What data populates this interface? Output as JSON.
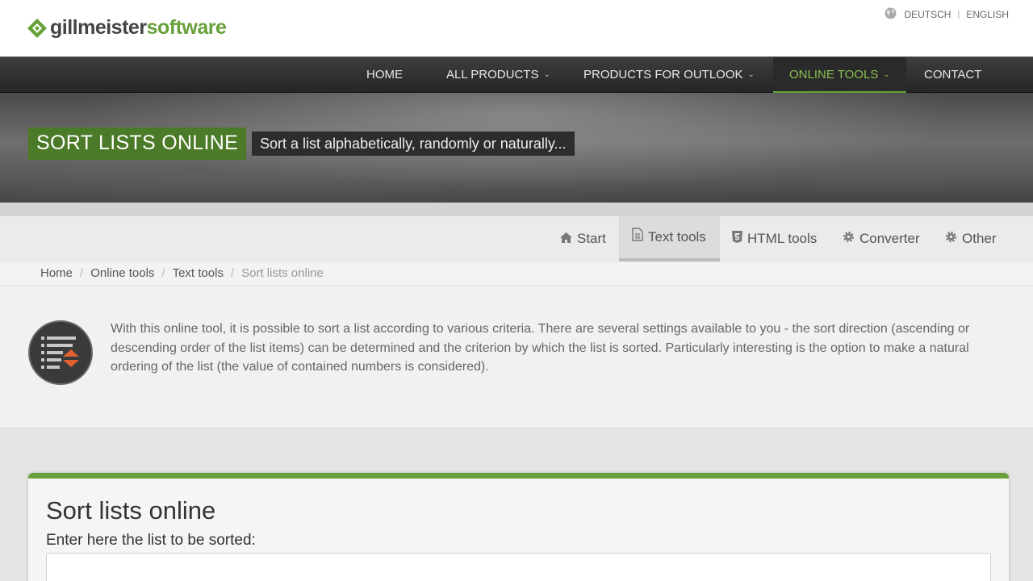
{
  "brand": {
    "name_part1": "gillmeister",
    "name_part2": "software",
    "colors": {
      "green": "#68a03a",
      "dark_text": "#444444"
    }
  },
  "language": {
    "icon": "globe-icon",
    "options": [
      "DEUTSCH",
      "ENGLISH"
    ],
    "separator": "|"
  },
  "nav": {
    "items": [
      {
        "label": "HOME",
        "dropdown": false
      },
      {
        "label": "ALL PRODUCTS",
        "dropdown": true
      },
      {
        "label": "PRODUCTS FOR OUTLOOK",
        "dropdown": true
      },
      {
        "label": "ONLINE TOOLS",
        "dropdown": true,
        "active": true
      },
      {
        "label": "CONTACT",
        "dropdown": false
      }
    ],
    "chevron": "⌄"
  },
  "hero": {
    "title": "SORT LISTS ONLINE",
    "subtitle": "Sort a list alphabetically, randomly or naturally..."
  },
  "subtabs": [
    {
      "label": "Start",
      "icon": "home-icon"
    },
    {
      "label": "Text tools",
      "icon": "document-icon",
      "active": true
    },
    {
      "label": "HTML tools",
      "icon": "html5-icon"
    },
    {
      "label": "Converter",
      "icon": "gear-icon"
    },
    {
      "label": "Other",
      "icon": "gear-icon"
    }
  ],
  "breadcrumb": {
    "items": [
      "Home",
      "Online tools",
      "Text tools",
      "Sort lists online"
    ],
    "separator": "/"
  },
  "intro": {
    "icon": "sort-list-icon",
    "text": "With this online tool, it is possible to sort a list according to various criteria. There are several settings available to you - the sort direction (ascending or descending order of the list items) can be determined and the criterion by which the list is sorted. Particularly interesting is the option to make a natural ordering of the list (the value of contained numbers is considered)."
  },
  "card": {
    "title": "Sort lists online",
    "input_label": "Enter here the list to be sorted:",
    "input_value": ""
  }
}
